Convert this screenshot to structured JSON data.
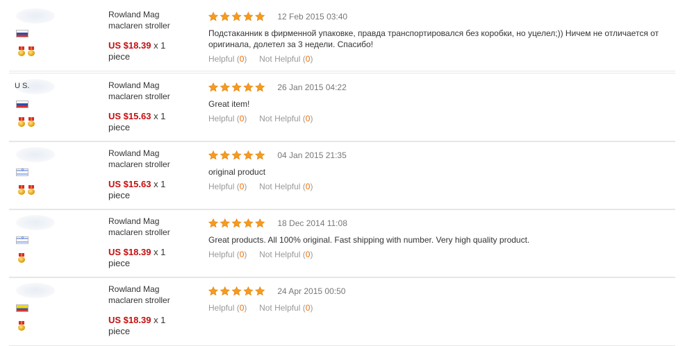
{
  "colors": {
    "price": "#c30e0e",
    "star": "#f59b1f",
    "count": "#f06d00",
    "divider": "#e6e6e6"
  },
  "icons": {
    "rating": "star-icon",
    "medal": "medal-icon"
  },
  "reviews": [
    {
      "user": {
        "name": "",
        "flag": "ru",
        "medals": 2
      },
      "product": {
        "line1": "Rowland Mag",
        "line2": "maclaren stroller"
      },
      "price": "US $18.39",
      "quantity": "x 1",
      "unit": "piece",
      "rating": 5,
      "date": "12 Feb 2015 03:40",
      "text": "Подстаканник в фирменной упаковке, правда транспортировался без коробки, но уцелел;)) Ничем не отличается от оригинала, долетел за 3 недели. Спасибо!",
      "helpful_label": "Helpful",
      "helpful_count": "0",
      "not_helpful_label": "Not Helpful",
      "not_helpful_count": "0"
    },
    {
      "user": {
        "name": "U S.",
        "flag": "ru",
        "medals": 2
      },
      "product": {
        "line1": "Rowland Mag",
        "line2": "maclaren stroller"
      },
      "price": "US $15.63",
      "quantity": "x 1",
      "unit": "piece",
      "rating": 5,
      "date": "26 Jan 2015 04:22",
      "text": "Great item!",
      "helpful_label": "Helpful",
      "helpful_count": "0",
      "not_helpful_label": "Not Helpful",
      "not_helpful_count": "0"
    },
    {
      "user": {
        "name": "",
        "flag": "il",
        "medals": 2
      },
      "product": {
        "line1": "Rowland Mag",
        "line2": "maclaren stroller"
      },
      "price": "US $15.63",
      "quantity": "x 1",
      "unit": "piece",
      "rating": 5,
      "date": "04 Jan 2015 21:35",
      "text": "original product",
      "helpful_label": "Helpful",
      "helpful_count": "0",
      "not_helpful_label": "Not Helpful",
      "not_helpful_count": "0"
    },
    {
      "user": {
        "name": "",
        "flag": "il",
        "medals": 1
      },
      "product": {
        "line1": "Rowland Mag",
        "line2": "maclaren stroller"
      },
      "price": "US $18.39",
      "quantity": "x 1",
      "unit": "piece",
      "rating": 5,
      "date": "18 Dec 2014 11:08",
      "text": "Great products. All 100% original. Fast shipping with number. Very high quality product.",
      "helpful_label": "Helpful",
      "helpful_count": "0",
      "not_helpful_label": "Not Helpful",
      "not_helpful_count": "0"
    },
    {
      "user": {
        "name": "",
        "flag": "co",
        "medals": 1
      },
      "product": {
        "line1": "Rowland Mag",
        "line2": "maclaren stroller"
      },
      "price": "US $18.39",
      "quantity": "x 1",
      "unit": "piece",
      "rating": 5,
      "date": "24 Apr 2015 00:50",
      "text": "",
      "helpful_label": "Helpful",
      "helpful_count": "0",
      "not_helpful_label": "Not Helpful",
      "not_helpful_count": "0"
    }
  ]
}
